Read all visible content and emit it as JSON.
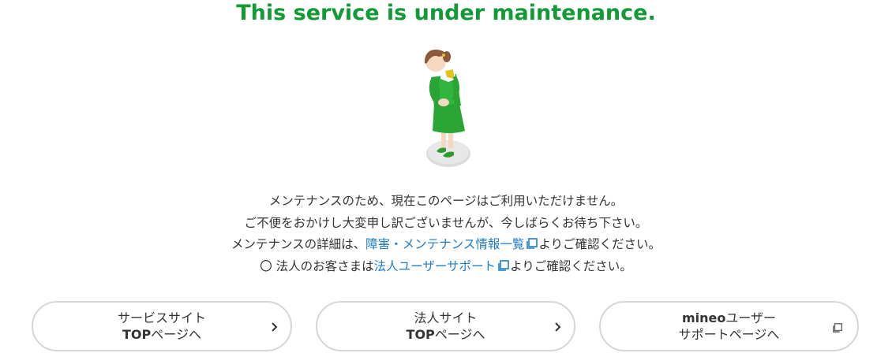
{
  "title": "This service is under maintenance.",
  "message": {
    "line1": "メンテナンスのため、現在このページはご利用いただけません。",
    "line2": "ご不便をおかけし大変申し訳ございませんが、今しばらくお待ち下さい。",
    "line3_prefix": "メンテナンスの詳細は、",
    "line3_link": "障害・メンテナンス情報一覧",
    "line3_suffix": "よりご確認ください。",
    "line4_prefix": "〇 法人のお客さまは",
    "line4_link": "法人ユーザーサポート",
    "line4_suffix": "よりご確認ください。"
  },
  "buttons": [
    {
      "line1": "サービスサイト",
      "line2_bold": "TOP",
      "line2_rest": "ページへ",
      "icon": "chevron-right-icon"
    },
    {
      "line1": "法人サイト",
      "line2_bold": "TOP",
      "line2_rest": "ページへ",
      "icon": "chevron-right-icon"
    },
    {
      "line1_bold": "mineo",
      "line1_rest": "ユーザー",
      "line2": "サポートページへ",
      "icon": "external-link-icon"
    }
  ],
  "colors": {
    "accent": "#129a37",
    "link": "#1d7ec4",
    "text": "#333333",
    "button_border": "#d6d6d6"
  }
}
